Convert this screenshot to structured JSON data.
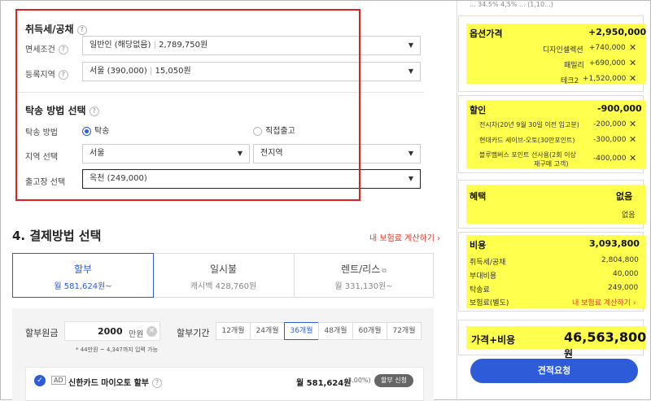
{
  "tax_section": {
    "title": "취득세/공채",
    "exemption_label": "면세조건",
    "exemption_value": "일반인 (해당없음) ",
    "exemption_amount": "2,789,750원",
    "region_label": "등록지역",
    "region_value": "서울 (390,000) ",
    "region_amount": "15,050원"
  },
  "delivery_section": {
    "title": "탁송 방법 선택",
    "method_label": "탁송 방법",
    "option_delivery": "탁송",
    "option_pickup": "직접출고",
    "area_label": "지역 선택",
    "area_value": "서울",
    "area_sub_value": "전지역",
    "center_label": "출고장 선택",
    "center_value": "옥천 (249,000)"
  },
  "payment": {
    "title": "4. 결제방법 선택",
    "calc_link": "내 보험료 계산하기 ›",
    "tabs": [
      {
        "label": "할부",
        "sub": "월 581,624원~"
      },
      {
        "label": "일시불",
        "sub": "캐시백 428,760원"
      },
      {
        "label": "렌트/리스",
        "sub": "월 331,130원~"
      }
    ],
    "principal_label": "할부원금",
    "principal_value": "2000",
    "principal_unit": "만원",
    "principal_hint": "* 44만원 ~ 4,347까지 입력 가능",
    "term_label": "할부기간",
    "terms": [
      "12개월",
      "24개월",
      "36개월",
      "48개월",
      "60개월",
      "72개월"
    ],
    "selected_term": "36개월",
    "loan": {
      "ad": "AD",
      "name": "신한카드 마이오토 할부",
      "amount": "월 581,624원",
      "rate": "(3.00%)",
      "apply": "할부 신청"
    }
  },
  "summary": {
    "top_cut": "... 34.5% 4,5% ... (1,10...)",
    "options": {
      "title": "옵션가격",
      "total": "+2,950,000",
      "items": [
        {
          "name": "디자인셀렉션",
          "value": "+740,000"
        },
        {
          "name": "패밀리",
          "value": "+690,000"
        },
        {
          "name": "테크2",
          "value": "+1,520,000"
        }
      ]
    },
    "discount": {
      "title": "할인",
      "total": "-900,000",
      "items": [
        {
          "name": "전시차(20년 9월 30일 이전 입고분)",
          "value": "-200,000"
        },
        {
          "name": "현대카드 세이브-오토(30만포인트)",
          "value": "-300,000"
        },
        {
          "name": "블루멤버스 포인트 선사용(2회 이상",
          "name2": "재구매 고객)",
          "value": "-400,000"
        }
      ]
    },
    "benefit": {
      "title": "혜택",
      "total": "없음",
      "sub": "없음"
    },
    "cost": {
      "title": "비용",
      "total": "3,093,800",
      "items": [
        {
          "name": "취득세/공채",
          "value": "2,804,800"
        },
        {
          "name": "부대비용",
          "value": "40,000"
        },
        {
          "name": "탁송료",
          "value": "249,000"
        },
        {
          "name": "보험료(별도)",
          "value": "내 보험료 계산하기 ›"
        }
      ]
    },
    "grand": {
      "label": "가격+비용",
      "value": "46,563,800",
      "unit": "원"
    },
    "estimate_button": "견적요청"
  }
}
